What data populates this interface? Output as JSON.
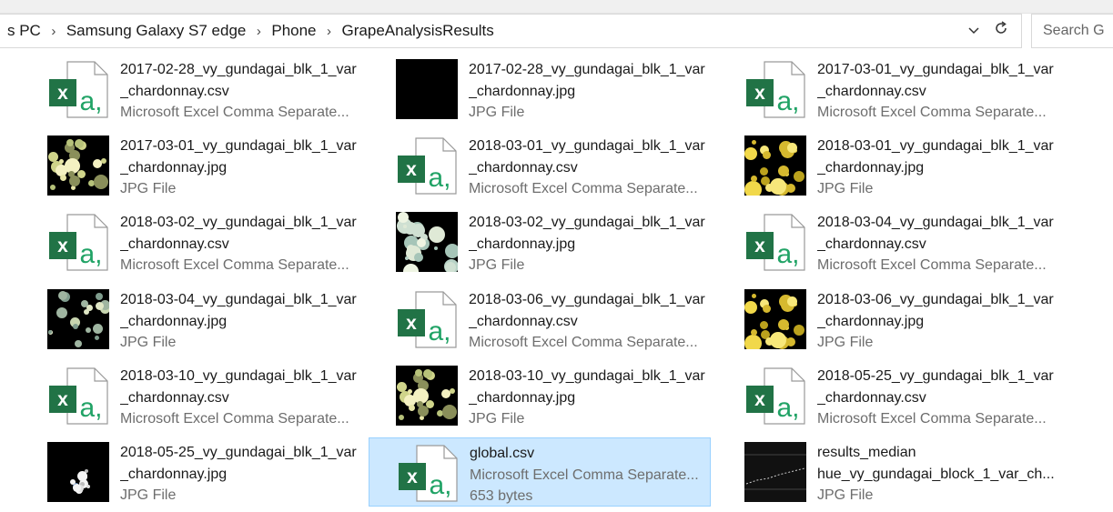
{
  "breadcrumb": [
    "s PC",
    "Samsung Galaxy S7 edge",
    "Phone",
    "GrapeAnalysisResults"
  ],
  "breadcrumb_separator": "›",
  "address": {
    "dropdown_icon": "chevron-down-icon",
    "refresh_icon": "refresh-icon"
  },
  "search": {
    "placeholder": "Search G"
  },
  "files": [
    {
      "line1": "2017-02-28_vy_gundagai_blk_1_var",
      "line2": "_chardonnay.csv",
      "line3": "Microsoft Excel Comma Separate...",
      "kind": "csv"
    },
    {
      "line1": "2017-02-28_vy_gundagai_blk_1_var",
      "line2": "_chardonnay.jpg",
      "line3": "JPG File",
      "kind": "photo-black"
    },
    {
      "line1": "2017-03-01_vy_gundagai_blk_1_var",
      "line2": "_chardonnay.csv",
      "line3": "Microsoft Excel Comma Separate...",
      "kind": "csv"
    },
    {
      "line1": "2017-03-01_vy_gundagai_blk_1_var",
      "line2": "_chardonnay.jpg",
      "line3": "JPG File",
      "kind": "photo-grapes"
    },
    {
      "line1": "2018-03-01_vy_gundagai_blk_1_var",
      "line2": "_chardonnay.csv",
      "line3": "Microsoft Excel Comma Separate...",
      "kind": "csv"
    },
    {
      "line1": "2018-03-01_vy_gundagai_blk_1_var",
      "line2": "_chardonnay.jpg",
      "line3": "JPG File",
      "kind": "photo-yellow"
    },
    {
      "line1": "2018-03-02_vy_gundagai_blk_1_var",
      "line2": "_chardonnay.csv",
      "line3": "Microsoft Excel Comma Separate...",
      "kind": "csv"
    },
    {
      "line1": "2018-03-02_vy_gundagai_blk_1_var",
      "line2": "_chardonnay.jpg",
      "line3": "JPG File",
      "kind": "photo-pale"
    },
    {
      "line1": "2018-03-04_vy_gundagai_blk_1_var",
      "line2": "_chardonnay.csv",
      "line3": "Microsoft Excel Comma Separate...",
      "kind": "csv"
    },
    {
      "line1": "2018-03-04_vy_gundagai_blk_1_var",
      "line2": "_chardonnay.jpg",
      "line3": "JPG File",
      "kind": "photo-sparse"
    },
    {
      "line1": "2018-03-06_vy_gundagai_blk_1_var",
      "line2": "_chardonnay.csv",
      "line3": "Microsoft Excel Comma Separate...",
      "kind": "csv"
    },
    {
      "line1": "2018-03-06_vy_gundagai_blk_1_var",
      "line2": "_chardonnay.jpg",
      "line3": "JPG File",
      "kind": "photo-yellow"
    },
    {
      "line1": "2018-03-10_vy_gundagai_blk_1_var",
      "line2": "_chardonnay.csv",
      "line3": "Microsoft Excel Comma Separate...",
      "kind": "csv"
    },
    {
      "line1": "2018-03-10_vy_gundagai_blk_1_var",
      "line2": "_chardonnay.jpg",
      "line3": "JPG File",
      "kind": "photo-grapes"
    },
    {
      "line1": "2018-05-25_vy_gundagai_blk_1_var",
      "line2": "_chardonnay.csv",
      "line3": "Microsoft Excel Comma Separate...",
      "kind": "csv"
    },
    {
      "line1": "2018-05-25_vy_gundagai_blk_1_var",
      "line2": "_chardonnay.jpg",
      "line3": "JPG File",
      "kind": "photo-small"
    },
    {
      "line1": "global.csv",
      "line2": "Microsoft Excel Comma Separate...",
      "line3": "653 bytes",
      "kind": "csv",
      "selected": true
    },
    {
      "line1": "results_median",
      "line2": "hue_vy_gundagai_block_1_var_ch...",
      "line3": "JPG File",
      "kind": "photo-plot"
    }
  ],
  "colors": {
    "selection_bg": "#cce8ff",
    "selection_border": "#99d1ff",
    "excel_green": "#217346",
    "secondary_text": "#6d6d6d"
  }
}
